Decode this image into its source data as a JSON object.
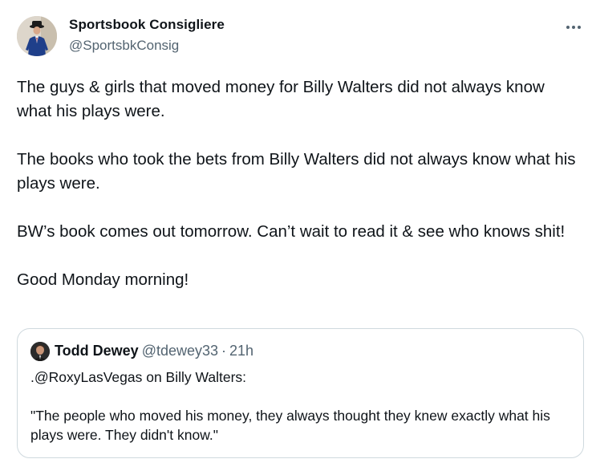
{
  "author": {
    "display_name": "Sportsbook Consigliere",
    "handle": "@SportsbkConsig",
    "avatar_icon": "profile-photo-man-in-suit-icon"
  },
  "menu": {
    "icon": "more-options-icon"
  },
  "tweet": {
    "paragraphs": [
      "The guys & girls that moved money for Billy Walters did not always know what his plays were.",
      "The books who took the bets from Billy Walters did not always know what his plays were.",
      "BW’s book comes out tomorrow. Can’t wait to read it & see who knows shit!",
      "Good Monday morning!"
    ]
  },
  "quoted_tweet": {
    "display_name": "Todd Dewey",
    "handle": "@tdewey33",
    "separator": "·",
    "time": "21h",
    "avatar_icon": "profile-photo-man-icon",
    "paragraphs": [
      ".@RoxyLasVegas on Billy Walters:",
      "\"The people who moved his money, they always thought they knew exactly what his plays were. They didn't know.\""
    ]
  },
  "colors": {
    "text_primary": "#0f1419",
    "text_secondary": "#536471",
    "border": "#cfd9de"
  }
}
